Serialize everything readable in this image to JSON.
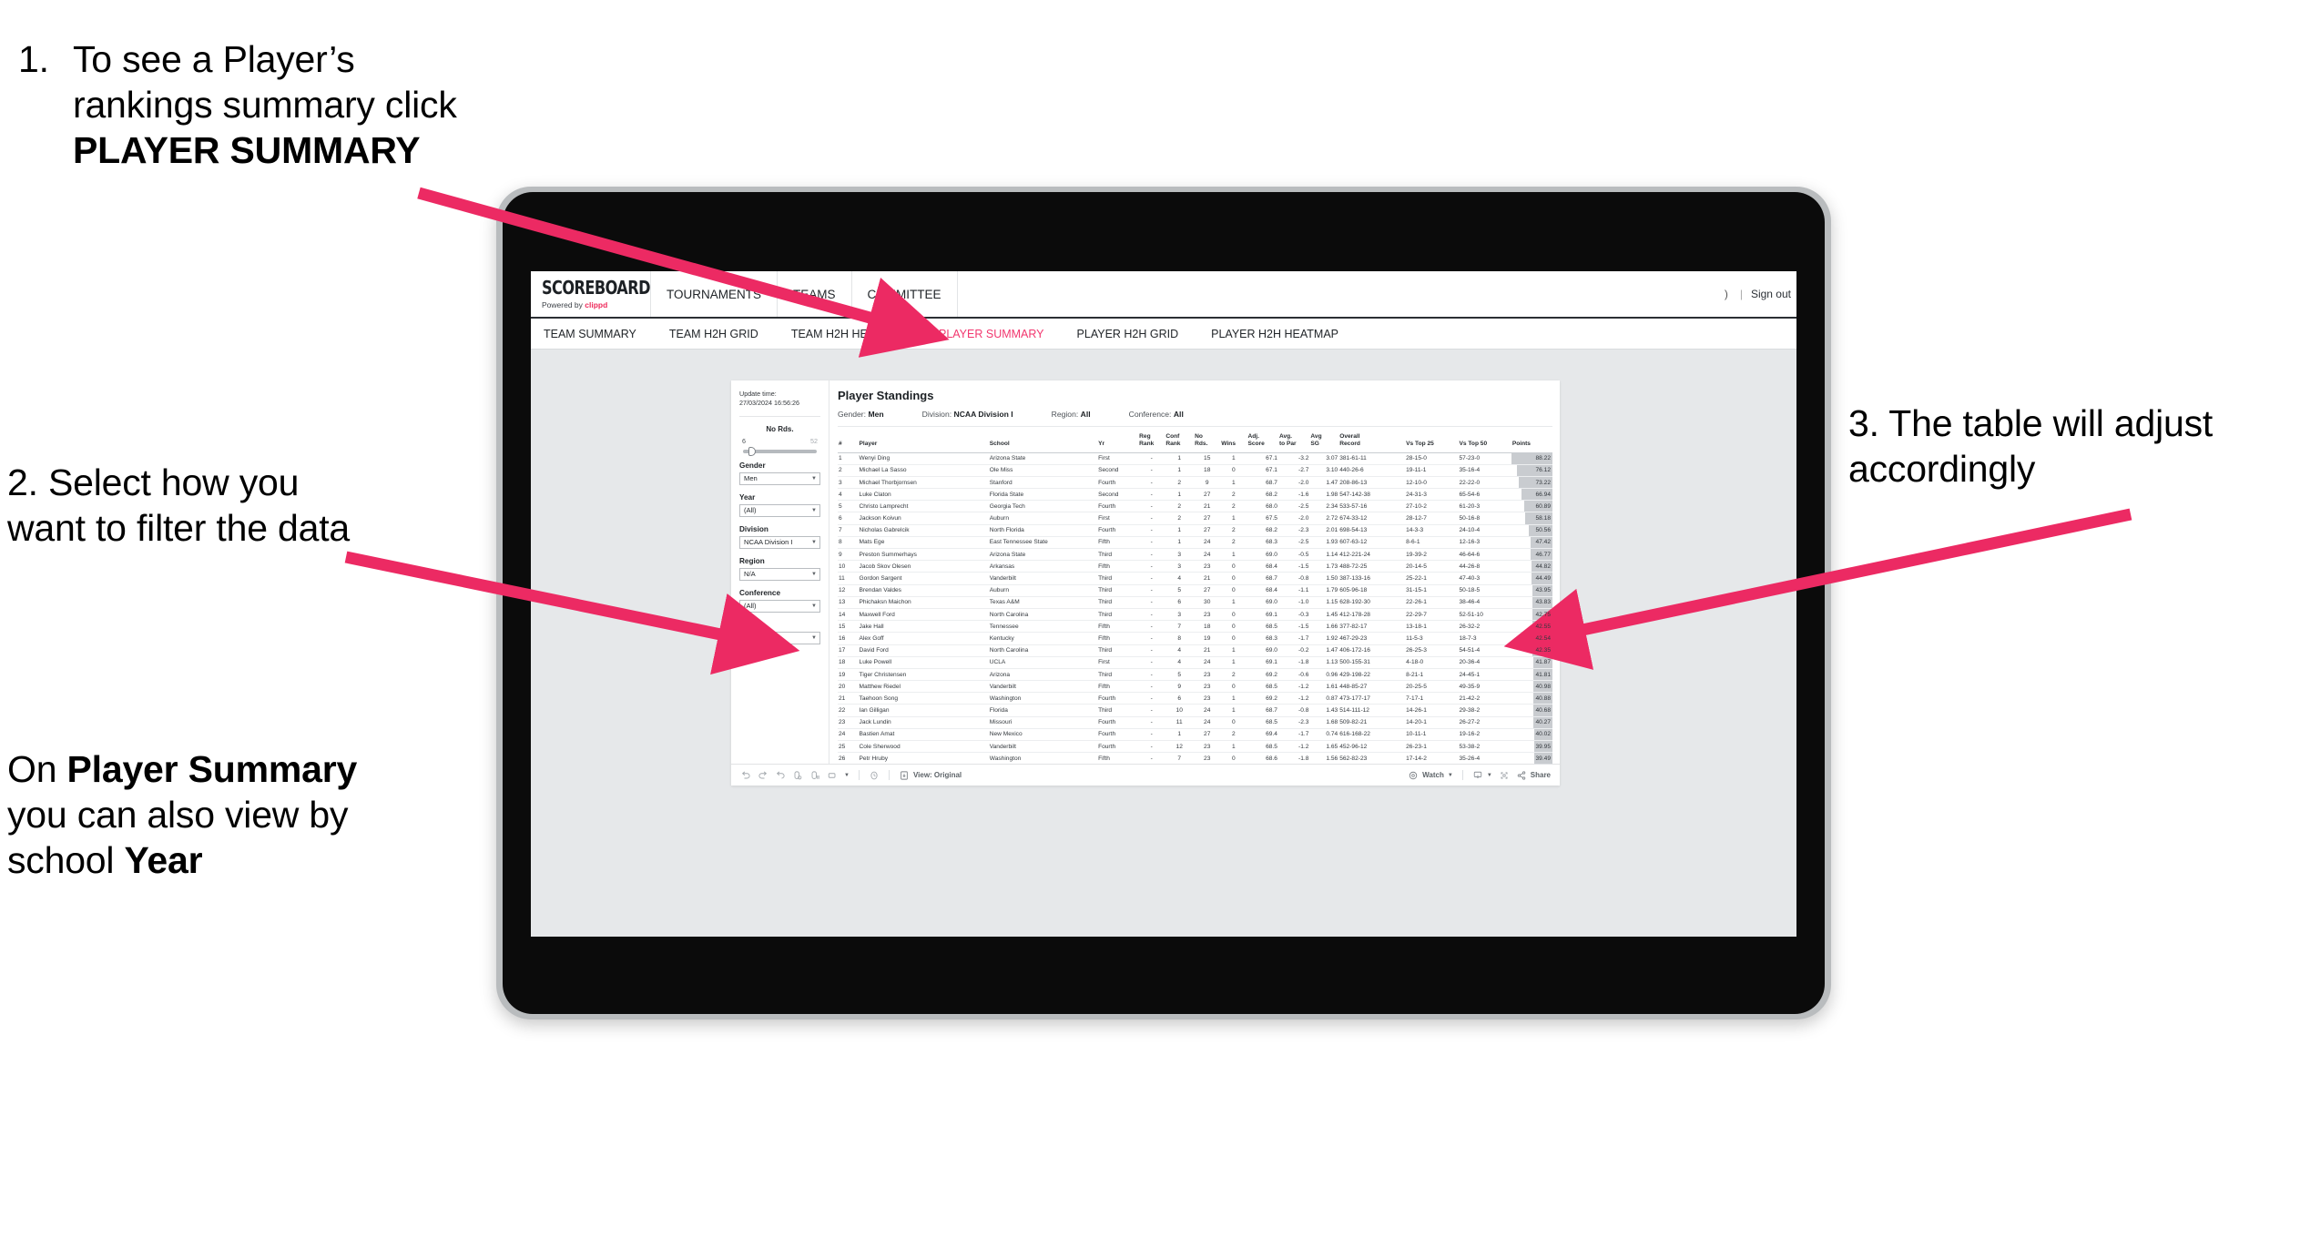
{
  "annotations": {
    "step1": {
      "number": "1.",
      "before": "To see a Player’s rankings summary click ",
      "bold": "PLAYER SUMMARY"
    },
    "step2": {
      "text": "2. Select how you want to filter the data"
    },
    "step2b": {
      "p1": "On ",
      "b1": "Player Summary",
      "p2": " you can also view by school ",
      "b2": "Year"
    },
    "step3": {
      "text": "3. The table will adjust accordingly"
    },
    "arrow_color": "#ec2a63"
  },
  "app": {
    "logo": {
      "main": "SCOREBOARD",
      "sub_prefix": "Powered by ",
      "sub_brand": "clippd"
    },
    "top_nav": [
      {
        "label": "TOURNAMENTS"
      },
      {
        "label": "TEAMS"
      },
      {
        "label": "COMMITTEE"
      }
    ],
    "header_right": {
      "truncated": ")",
      "separator": "|",
      "signout": "Sign out"
    },
    "sub_nav": [
      {
        "label": "TEAM SUMMARY",
        "active": false
      },
      {
        "label": "TEAM H2H GRID",
        "active": false
      },
      {
        "label": "TEAM H2H HEATMAP",
        "active": false
      },
      {
        "label": "PLAYER SUMMARY",
        "active": true
      },
      {
        "label": "PLAYER H2H GRID",
        "active": false
      },
      {
        "label": "PLAYER H2H HEATMAP",
        "active": false
      }
    ],
    "active_tab_color": "#f2376f"
  },
  "filters": {
    "update_time_label": "Update time:",
    "update_time_value": "27/03/2024 16:56:26",
    "slider": {
      "label": "No Rds.",
      "min": "6",
      "max": "52",
      "value_pct": 8
    },
    "selects": [
      {
        "label": "Gender",
        "value": "Men"
      },
      {
        "label": "Year",
        "value": "(All)"
      },
      {
        "label": "Division",
        "value": "NCAA Division I"
      },
      {
        "label": "Region",
        "value": "N/A"
      },
      {
        "label": "Conference",
        "value": "(All)"
      },
      {
        "label": "Player",
        "value": "(All)"
      }
    ]
  },
  "viz": {
    "title": "Player Standings",
    "summary": [
      {
        "label": "Gender:",
        "value": "Men"
      },
      {
        "label": "Division:",
        "value": "NCAA Division I"
      },
      {
        "label": "Region:",
        "value": "All"
      },
      {
        "label": "Conference:",
        "value": "All"
      }
    ],
    "columns": [
      {
        "l1": "#",
        "l2": ""
      },
      {
        "l1": "Player",
        "l2": ""
      },
      {
        "l1": "School",
        "l2": ""
      },
      {
        "l1": "Yr",
        "l2": ""
      },
      {
        "l1": "Reg",
        "l2": "Rank"
      },
      {
        "l1": "Conf",
        "l2": "Rank"
      },
      {
        "l1": "No",
        "l2": "Rds."
      },
      {
        "l1": "",
        "l2": "Wins"
      },
      {
        "l1": "Adj.",
        "l2": "Score"
      },
      {
        "l1": "Avg.",
        "l2": "to Par"
      },
      {
        "l1": "Avg",
        "l2": "SG"
      },
      {
        "l1": "Overall",
        "l2": "Record"
      },
      {
        "l1": "",
        "l2": "Vs Top 25"
      },
      {
        "l1": "",
        "l2": "Vs Top 50"
      },
      {
        "l1": "",
        "l2": "Points"
      }
    ],
    "rows": [
      [
        "1",
        "Wenyi Ding",
        "Arizona State",
        "First",
        "-",
        "1",
        "15",
        "1",
        "67.1",
        "-3.2",
        "3.07",
        "381-61-11",
        "28-15-0",
        "57-23-0",
        "88.22"
      ],
      [
        "2",
        "Michael La Sasso",
        "Ole Miss",
        "Second",
        "-",
        "1",
        "18",
        "0",
        "67.1",
        "-2.7",
        "3.10",
        "440-26-6",
        "19-11-1",
        "35-16-4",
        "76.12"
      ],
      [
        "3",
        "Michael Thorbjornsen",
        "Stanford",
        "Fourth",
        "-",
        "2",
        "9",
        "1",
        "68.7",
        "-2.0",
        "1.47",
        "208-86-13",
        "12-10-0",
        "22-22-0",
        "73.22"
      ],
      [
        "4",
        "Luke Claton",
        "Florida State",
        "Second",
        "-",
        "1",
        "27",
        "2",
        "68.2",
        "-1.6",
        "1.98",
        "547-142-38",
        "24-31-3",
        "65-54-6",
        "66.94"
      ],
      [
        "5",
        "Christo Lamprecht",
        "Georgia Tech",
        "Fourth",
        "-",
        "2",
        "21",
        "2",
        "68.0",
        "-2.5",
        "2.34",
        "533-57-16",
        "27-10-2",
        "61-20-3",
        "60.89"
      ],
      [
        "6",
        "Jackson Koivun",
        "Auburn",
        "First",
        "-",
        "2",
        "27",
        "1",
        "67.5",
        "-2.0",
        "2.72",
        "674-33-12",
        "28-12-7",
        "50-16-8",
        "58.18"
      ],
      [
        "7",
        "Nicholas Gabrelcik",
        "North Florida",
        "Fourth",
        "-",
        "1",
        "27",
        "2",
        "68.2",
        "-2.3",
        "2.01",
        "698-54-13",
        "14-3-3",
        "24-10-4",
        "50.56"
      ],
      [
        "8",
        "Mats Ege",
        "East Tennessee State",
        "Fifth",
        "-",
        "1",
        "24",
        "2",
        "68.3",
        "-2.5",
        "1.93",
        "607-63-12",
        "8-6-1",
        "12-16-3",
        "47.42"
      ],
      [
        "9",
        "Preston Summerhays",
        "Arizona State",
        "Third",
        "-",
        "3",
        "24",
        "1",
        "69.0",
        "-0.5",
        "1.14",
        "412-221-24",
        "19-39-2",
        "46-64-6",
        "46.77"
      ],
      [
        "10",
        "Jacob Skov Olesen",
        "Arkansas",
        "Fifth",
        "-",
        "3",
        "23",
        "0",
        "68.4",
        "-1.5",
        "1.73",
        "488-72-25",
        "20-14-5",
        "44-26-8",
        "44.82"
      ],
      [
        "11",
        "Gordon Sargent",
        "Vanderbilt",
        "Third",
        "-",
        "4",
        "21",
        "0",
        "68.7",
        "-0.8",
        "1.50",
        "387-133-16",
        "25-22-1",
        "47-40-3",
        "44.49"
      ],
      [
        "12",
        "Brendan Valdes",
        "Auburn",
        "Third",
        "-",
        "5",
        "27",
        "0",
        "68.4",
        "-1.1",
        "1.79",
        "605-96-18",
        "31-15-1",
        "50-18-5",
        "43.95"
      ],
      [
        "13",
        "Phichaksn Maichon",
        "Texas A&M",
        "Third",
        "-",
        "6",
        "30",
        "1",
        "69.0",
        "-1.0",
        "1.15",
        "628-192-30",
        "22-26-1",
        "38-46-4",
        "43.83"
      ],
      [
        "14",
        "Maxwell Ford",
        "North Carolina",
        "Third",
        "-",
        "3",
        "23",
        "0",
        "69.1",
        "-0.3",
        "1.45",
        "412-178-28",
        "22-29-7",
        "52-51-10",
        "42.75"
      ],
      [
        "15",
        "Jake Hall",
        "Tennessee",
        "Fifth",
        "-",
        "7",
        "18",
        "0",
        "68.5",
        "-1.5",
        "1.66",
        "377-82-17",
        "13-18-1",
        "26-32-2",
        "42.55"
      ],
      [
        "16",
        "Alex Goff",
        "Kentucky",
        "Fifth",
        "-",
        "8",
        "19",
        "0",
        "68.3",
        "-1.7",
        "1.92",
        "467-29-23",
        "11-5-3",
        "18-7-3",
        "42.54"
      ],
      [
        "17",
        "David Ford",
        "North Carolina",
        "Third",
        "-",
        "4",
        "21",
        "1",
        "69.0",
        "-0.2",
        "1.47",
        "406-172-16",
        "26-25-3",
        "54-51-4",
        "42.35"
      ],
      [
        "18",
        "Luke Powell",
        "UCLA",
        "First",
        "-",
        "4",
        "24",
        "1",
        "69.1",
        "-1.8",
        "1.13",
        "500-155-31",
        "4-18-0",
        "20-36-4",
        "41.87"
      ],
      [
        "19",
        "Tiger Christensen",
        "Arizona",
        "Third",
        "-",
        "5",
        "23",
        "2",
        "69.2",
        "-0.6",
        "0.96",
        "429-198-22",
        "8-21-1",
        "24-45-1",
        "41.81"
      ],
      [
        "20",
        "Matthew Riedel",
        "Vanderbilt",
        "Fifth",
        "-",
        "9",
        "23",
        "0",
        "68.5",
        "-1.2",
        "1.61",
        "448-85-27",
        "20-25-5",
        "49-35-9",
        "40.98"
      ],
      [
        "21",
        "Taehoon Song",
        "Washington",
        "Fourth",
        "-",
        "6",
        "23",
        "1",
        "69.2",
        "-1.2",
        "0.87",
        "473-177-17",
        "7-17-1",
        "21-42-2",
        "40.88"
      ],
      [
        "22",
        "Ian Gilligan",
        "Florida",
        "Third",
        "-",
        "10",
        "24",
        "1",
        "68.7",
        "-0.8",
        "1.43",
        "514-111-12",
        "14-26-1",
        "29-38-2",
        "40.68"
      ],
      [
        "23",
        "Jack Lundin",
        "Missouri",
        "Fourth",
        "-",
        "11",
        "24",
        "0",
        "68.5",
        "-2.3",
        "1.68",
        "509-82-21",
        "14-20-1",
        "26-27-2",
        "40.27"
      ],
      [
        "24",
        "Bastien Amat",
        "New Mexico",
        "Fourth",
        "-",
        "1",
        "27",
        "2",
        "69.4",
        "-1.7",
        "0.74",
        "616-168-22",
        "10-11-1",
        "19-16-2",
        "40.02"
      ],
      [
        "25",
        "Cole Sherwood",
        "Vanderbilt",
        "Fourth",
        "-",
        "12",
        "23",
        "1",
        "68.5",
        "-1.2",
        "1.65",
        "452-96-12",
        "26-23-1",
        "53-38-2",
        "39.95"
      ],
      [
        "26",
        "Petr Hruby",
        "Washington",
        "Fifth",
        "-",
        "7",
        "23",
        "0",
        "68.6",
        "-1.8",
        "1.56",
        "562-82-23",
        "17-14-2",
        "35-26-4",
        "39.49"
      ]
    ],
    "points_max": 88.22,
    "points_bar_color": "#c9ccd0"
  },
  "toolbar": {
    "view_label": "View: Original",
    "watch_label": "Watch",
    "share_label": "Share",
    "icons": [
      "undo-icon",
      "redo-icon",
      "revert-icon",
      "pause-refresh-icon",
      "refresh-icon",
      "layout-icon",
      "chevron-down-icon",
      "zoom-icon",
      "view-icon",
      "watch-icon",
      "device-icon",
      "fullscreen-icon",
      "share-icon"
    ]
  }
}
